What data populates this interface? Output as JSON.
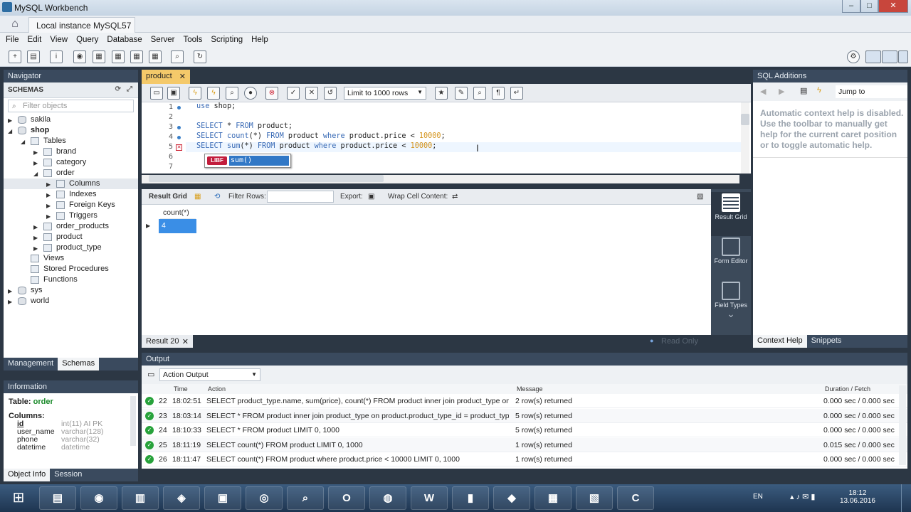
{
  "window": {
    "title": "MySQL Workbench",
    "tab": "Local instance MySQL57",
    "controls": [
      "–",
      "□",
      "✕"
    ]
  },
  "menu": [
    "File",
    "Edit",
    "View",
    "Query",
    "Database",
    "Server",
    "Tools",
    "Scripting",
    "Help"
  ],
  "navigator": {
    "title": "Navigator",
    "schemas_label": "SCHEMAS",
    "filter_placeholder": "Filter objects",
    "tree": [
      {
        "label": "sakila",
        "level": 0,
        "arrow": "▶",
        "icon": "db"
      },
      {
        "label": "shop",
        "level": 0,
        "arrow": "◢",
        "icon": "db",
        "bold": true
      },
      {
        "label": "Tables",
        "level": 1,
        "arrow": "◢",
        "icon": "folder"
      },
      {
        "label": "brand",
        "level": 2,
        "arrow": "▶",
        "icon": "table"
      },
      {
        "label": "category",
        "level": 2,
        "arrow": "▶",
        "icon": "table"
      },
      {
        "label": "order",
        "level": 2,
        "arrow": "◢",
        "icon": "table"
      },
      {
        "label": "Columns",
        "level": 3,
        "arrow": "▶",
        "icon": "col",
        "selected": true
      },
      {
        "label": "Indexes",
        "level": 3,
        "arrow": "▶",
        "icon": "col"
      },
      {
        "label": "Foreign Keys",
        "level": 3,
        "arrow": "▶",
        "icon": "col"
      },
      {
        "label": "Triggers",
        "level": 3,
        "arrow": "▶",
        "icon": "col"
      },
      {
        "label": "order_products",
        "level": 2,
        "arrow": "▶",
        "icon": "table"
      },
      {
        "label": "product",
        "level": 2,
        "arrow": "▶",
        "icon": "table"
      },
      {
        "label": "product_type",
        "level": 2,
        "arrow": "▶",
        "icon": "table"
      },
      {
        "label": "Views",
        "level": 1,
        "arrow": "",
        "icon": "folder"
      },
      {
        "label": "Stored Procedures",
        "level": 1,
        "arrow": "",
        "icon": "folder"
      },
      {
        "label": "Functions",
        "level": 1,
        "arrow": "",
        "icon": "folder"
      },
      {
        "label": "sys",
        "level": 0,
        "arrow": "▶",
        "icon": "db"
      },
      {
        "label": "world",
        "level": 0,
        "arrow": "▶",
        "icon": "db"
      }
    ],
    "tabs": [
      "Management",
      "Schemas"
    ]
  },
  "information": {
    "title": "Information",
    "table_label": "Table:",
    "table_name": "order",
    "columns_label": "Columns:",
    "columns": [
      {
        "name": "id",
        "type": "int(11) AI PK"
      },
      {
        "name": "user_name",
        "type": "varchar(128)"
      },
      {
        "name": "phone",
        "type": "varchar(32)"
      },
      {
        "name": "datetime",
        "type": "datetime"
      }
    ],
    "tabs": [
      "Object Info",
      "Session"
    ]
  },
  "editor": {
    "tab": "product",
    "limit": "Limit to 1000 rows",
    "lines": [
      {
        "n": "1",
        "marker": "dot",
        "code": "use shop;"
      },
      {
        "n": "2",
        "marker": "",
        "code": ""
      },
      {
        "n": "3",
        "marker": "dot",
        "code": "SELECT * FROM product;"
      },
      {
        "n": "4",
        "marker": "dot",
        "code": "SELECT count(*) FROM product where product.price < 10000;"
      },
      {
        "n": "5",
        "marker": "err",
        "code": "SELECT sum(*) FROM product where product.price < 10000;"
      },
      {
        "n": "6",
        "marker": "",
        "code": ""
      },
      {
        "n": "7",
        "marker": "",
        "code": ""
      }
    ],
    "autocomplete": {
      "badge": "LIBF",
      "item": "sum()"
    }
  },
  "result": {
    "toolbar": {
      "grid": "Result Grid",
      "filter": "Filter Rows:",
      "export": "Export:",
      "wrap": "Wrap Cell Content:"
    },
    "column": "count(*)",
    "value": "4",
    "footer_tab": "Result 20",
    "read_only": "Read Only",
    "side": [
      {
        "label": "Result Grid"
      },
      {
        "label": "Form Editor"
      },
      {
        "label": "Field Types"
      }
    ]
  },
  "sql_additions": {
    "title": "SQL Additions",
    "jump": "Jump to",
    "help": "Automatic context help is disabled. Use the toolbar to manually get help for the current caret position or to toggle automatic help.",
    "tabs": [
      "Context Help",
      "Snippets"
    ]
  },
  "output": {
    "title": "Output",
    "mode": "Action Output",
    "cols": {
      "time": "Time",
      "action": "Action",
      "message": "Message",
      "duration": "Duration / Fetch"
    },
    "rows": [
      {
        "n": "22",
        "time": "18:02:51",
        "action": "SELECT product_type.name, sum(price), count(*) FROM product inner join  product_type on pr...",
        "message": "2 row(s) returned",
        "duration": "0.000 sec / 0.000 sec"
      },
      {
        "n": "23",
        "time": "18:03:14",
        "action": "SELECT * FROM product inner join  product_type on product.product_type_id = product_type....",
        "message": "5 row(s) returned",
        "duration": "0.000 sec / 0.000 sec"
      },
      {
        "n": "24",
        "time": "18:10:33",
        "action": "SELECT * FROM product LIMIT 0, 1000",
        "message": "5 row(s) returned",
        "duration": "0.000 sec / 0.000 sec"
      },
      {
        "n": "25",
        "time": "18:11:19",
        "action": "SELECT count(*) FROM product LIMIT 0, 1000",
        "message": "1 row(s) returned",
        "duration": "0.015 sec / 0.000 sec"
      },
      {
        "n": "26",
        "time": "18:11:47",
        "action": "SELECT count(*) FROM product where product.price < 10000 LIMIT 0, 1000",
        "message": "1 row(s) returned",
        "duration": "0.000 sec / 0.000 sec"
      }
    ]
  },
  "taskbar": {
    "lang": "EN",
    "time": "18:12",
    "date": "13.06.2016",
    "apps": [
      "file-manager",
      "firefox",
      "ide",
      "vpn",
      "computer",
      "chrome",
      "search",
      "opera",
      "pin",
      "word",
      "terminal",
      "workbench",
      "toolbox",
      "presentation",
      "cleaner"
    ]
  },
  "colors": {
    "accent": "#3178c6",
    "panel_header": "#3a4a5e",
    "tab_active": "#f4c96a",
    "ok": "#27a23b"
  }
}
